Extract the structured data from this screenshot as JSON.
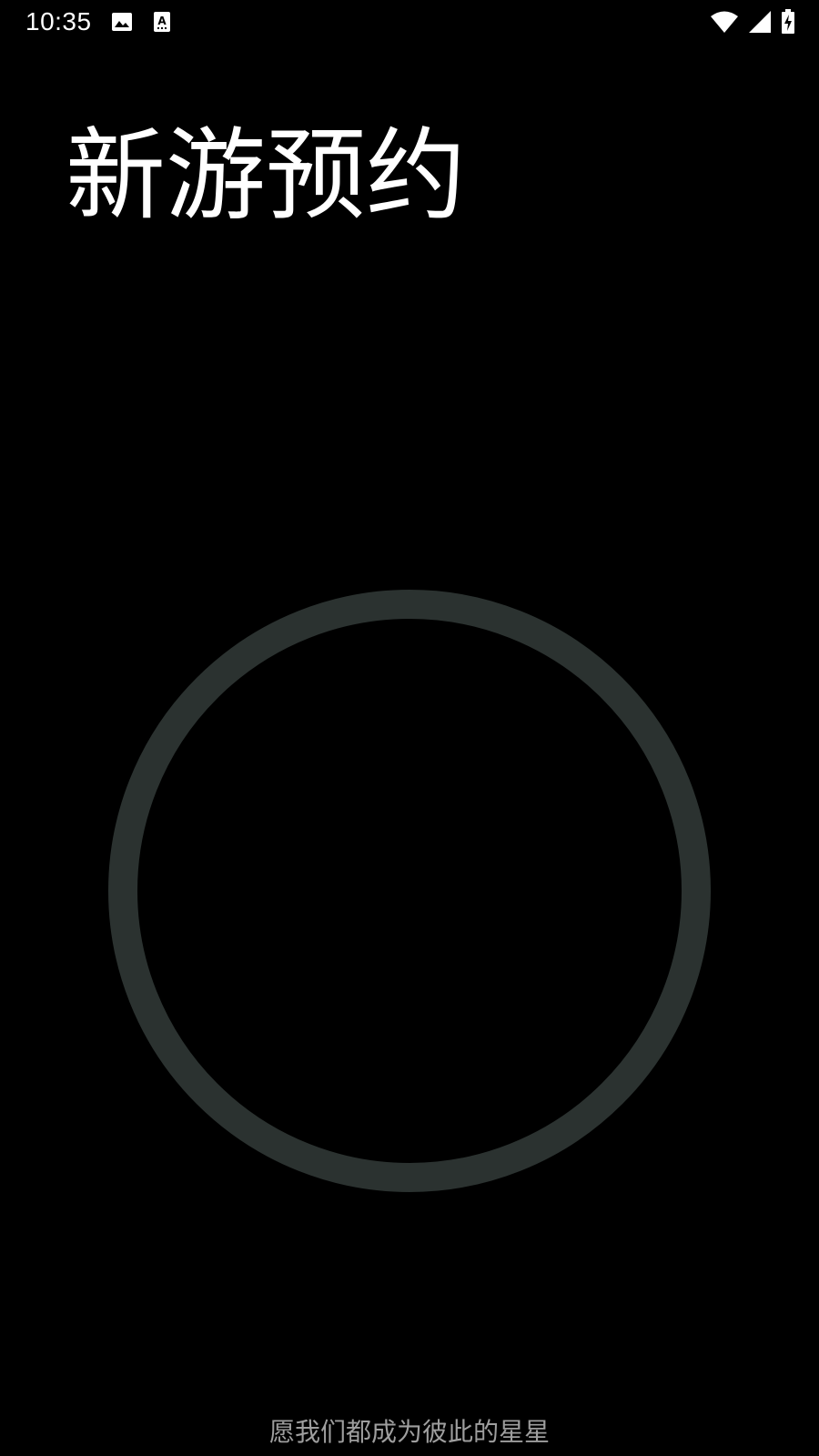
{
  "status_bar": {
    "time": "10:35",
    "left_icons": [
      "image-icon",
      "keyboard-a-icon"
    ],
    "right_icons": [
      "wifi-icon",
      "cellular-signal-icon",
      "battery-charging-icon"
    ]
  },
  "main": {
    "title": "新游预约",
    "ring_color": "#2b3230"
  },
  "footer": {
    "slogan": "愿我们都成为彼此的星星"
  },
  "colors": {
    "background": "#000000",
    "title": "#ffffff",
    "slogan": "#9e9e9e"
  }
}
